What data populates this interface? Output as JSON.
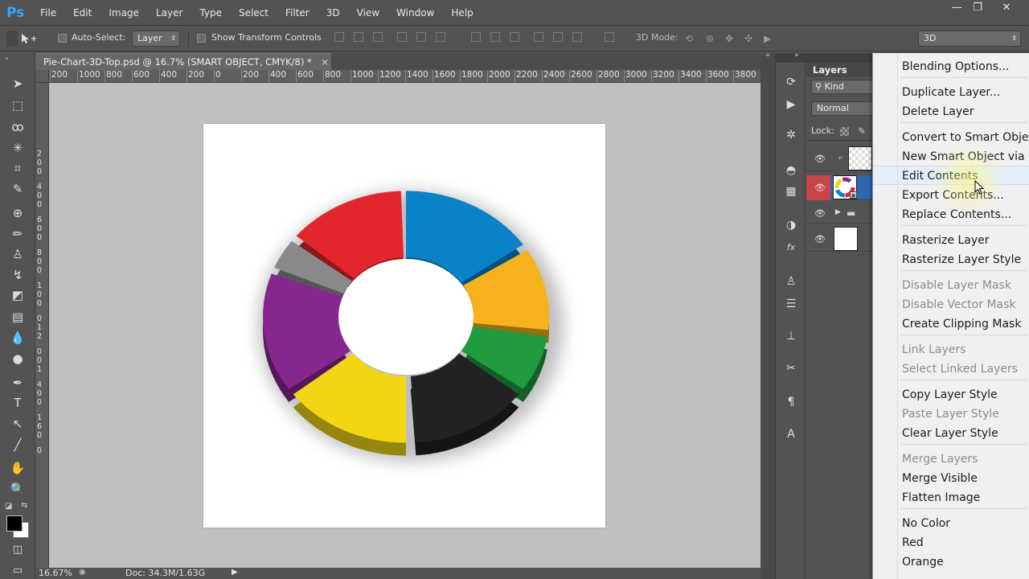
{
  "app": {
    "logo": "Ps"
  },
  "menubar": {
    "items": [
      "File",
      "Edit",
      "Image",
      "Layer",
      "Type",
      "Select",
      "Filter",
      "3D",
      "View",
      "Window",
      "Help"
    ]
  },
  "window_controls": {
    "minimize": "—",
    "maximize": "❐",
    "close": "✕"
  },
  "options_bar": {
    "auto_select_label": "Auto-Select:",
    "auto_select_value": "Layer",
    "show_transform_label": "Show Transform Controls",
    "mode_3d_label": "3D Mode:",
    "workspace_value": "3D"
  },
  "document": {
    "tab_title": "Pie-Chart-3D-Top.psd @ 16.7% (SMART OBJECT, CMYK/8) *",
    "tab_close": "×",
    "ruler_top": [
      "200",
      "1000",
      "800",
      "600",
      "400",
      "200",
      "0",
      "200",
      "400",
      "600",
      "800",
      "1000",
      "1200",
      "1400",
      "1600",
      "1800",
      "2000",
      "2200",
      "2400",
      "2600",
      "2800",
      "3000",
      "3200",
      "3400",
      "3600",
      "3800",
      "400"
    ],
    "ruler_left": [
      "2",
      "0",
      "0",
      "4",
      "0",
      "0",
      "6",
      "0",
      "0",
      "8",
      "0",
      "0",
      "1",
      "0",
      "0",
      "0",
      "1",
      "2",
      "0",
      "0",
      "1",
      "4",
      "0",
      "0",
      "1",
      "6",
      "0",
      "0"
    ]
  },
  "status": {
    "zoom": "16.67%",
    "doc_info": "Doc: 34.3M/1.63G"
  },
  "chart_data": {
    "type": "pie",
    "segments": [
      {
        "color": "#0a82c8",
        "start_deg": 0,
        "sweep_deg": 55
      },
      {
        "color": "#f5b21c",
        "start_deg": 58,
        "sweep_deg": 38
      },
      {
        "color": "#1f9a3c",
        "start_deg": 99,
        "sweep_deg": 26
      },
      {
        "color": "#222222",
        "start_deg": 128,
        "sweep_deg": 48
      },
      {
        "color": "#f2d616",
        "start_deg": 180,
        "sweep_deg": 52
      },
      {
        "color": "#86268f",
        "start_deg": 235,
        "sweep_deg": 55
      },
      {
        "color": "#8a8a8a",
        "start_deg": 293,
        "sweep_deg": 14
      },
      {
        "color": "#e3262d",
        "start_deg": 310,
        "sweep_deg": 48
      }
    ]
  },
  "layers_panel": {
    "tab_label": "Layers",
    "filter_label": "Kind",
    "blend_mode": "Normal",
    "lock_label": "Lock:"
  },
  "context_menu": {
    "items": [
      {
        "label": "Blending Options...",
        "enabled": true
      },
      {
        "label": "Duplicate Layer...",
        "enabled": true
      },
      {
        "label": "Delete Layer",
        "enabled": true
      },
      {
        "label": "Convert to Smart Object",
        "enabled": true
      },
      {
        "label": "New Smart Object via Co",
        "enabled": true
      },
      {
        "label": "Edit Contents",
        "enabled": true,
        "highlighted": true
      },
      {
        "label": "Export Contents...",
        "enabled": true
      },
      {
        "label": "Replace Contents...",
        "enabled": true
      },
      {
        "label": "Rasterize Layer",
        "enabled": true
      },
      {
        "label": "Rasterize Layer Style",
        "enabled": true
      },
      {
        "label": "Disable Layer Mask",
        "enabled": false
      },
      {
        "label": "Disable Vector Mask",
        "enabled": false
      },
      {
        "label": "Create Clipping Mask",
        "enabled": true
      },
      {
        "label": "Link Layers",
        "enabled": false
      },
      {
        "label": "Select Linked Layers",
        "enabled": false
      },
      {
        "label": "Copy Layer Style",
        "enabled": true
      },
      {
        "label": "Paste Layer Style",
        "enabled": false
      },
      {
        "label": "Clear Layer Style",
        "enabled": true
      },
      {
        "label": "Merge Layers",
        "enabled": false
      },
      {
        "label": "Merge Visible",
        "enabled": true
      },
      {
        "label": "Flatten Image",
        "enabled": true
      },
      {
        "label": "No Color",
        "enabled": true
      },
      {
        "label": "Red",
        "enabled": true
      },
      {
        "label": "Orange",
        "enabled": true
      }
    ]
  }
}
